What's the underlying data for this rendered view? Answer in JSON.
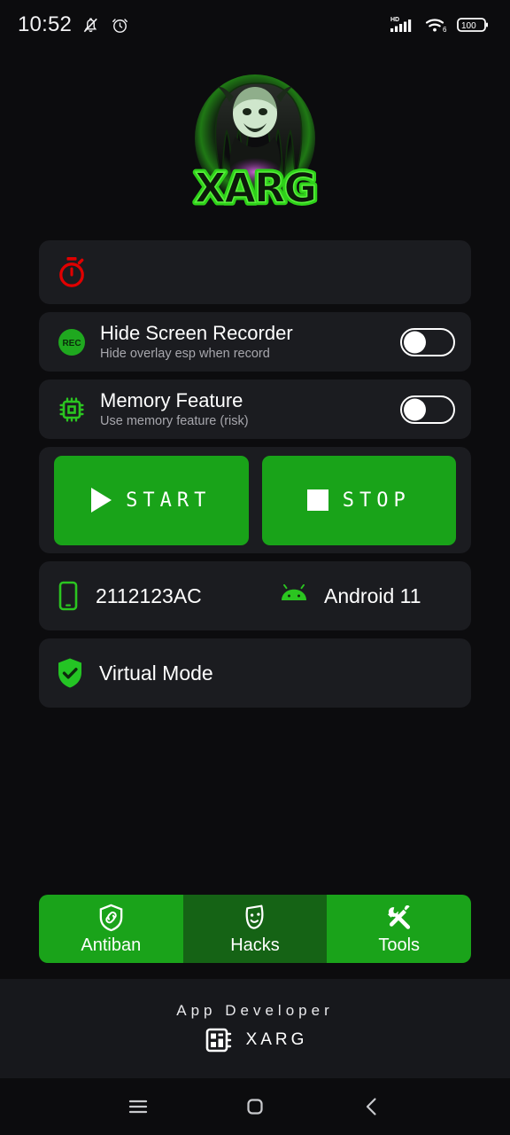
{
  "statusbar": {
    "time": "10:52",
    "icons_left": [
      "bell-muted-icon",
      "alarm-clock-icon"
    ],
    "hd_label": "HD",
    "wifi_generation": "6",
    "battery_level": "100",
    "icons_right": [
      "hd-signal-icon",
      "wifi-6-icon",
      "battery-icon"
    ]
  },
  "logo": {
    "name": "xarg-logo",
    "wordmark": "XARG",
    "glow_color": "#2fd21a"
  },
  "timer_card": {
    "icon": "stopwatch-icon",
    "icon_color": "#e00000"
  },
  "toggles": [
    {
      "icon": "rec-icon",
      "icon_label": "REC",
      "title": "Hide Screen Recorder",
      "subtitle": "Hide overlay esp when record",
      "state": "off"
    },
    {
      "icon": "memory-chip-icon",
      "title": "Memory Feature",
      "subtitle": "Use memory feature (risk)",
      "state": "off"
    }
  ],
  "actions": {
    "start_label": "START",
    "stop_label": "STOP",
    "start_icon": "play-icon",
    "stop_icon": "stop-icon",
    "button_color": "#19a319"
  },
  "device": {
    "model_icon": "phone-icon",
    "model": "2112123AC",
    "os_icon": "android-icon",
    "os": "Android 11"
  },
  "virtual_mode": {
    "icon": "shield-check-icon",
    "label": "Virtual Mode"
  },
  "tabs": [
    {
      "label": "Antiban",
      "icon": "shield-link-icon",
      "selected": false
    },
    {
      "label": "Hacks",
      "icon": "theater-mask-icon",
      "selected": true
    },
    {
      "label": "Tools",
      "icon": "wrench-screwdriver-icon",
      "selected": false
    }
  ],
  "footer": {
    "title": "App Developer",
    "icon": "chip-icon",
    "developer": "XARG"
  },
  "navbar": {
    "recents_icon": "menu-icon",
    "home_icon": "home-square-icon",
    "back_icon": "back-chevron-icon"
  },
  "colors": {
    "background": "#0c0c0e",
    "card": "#1b1c20",
    "accent_green": "#19a319",
    "accent_green_dark": "#156315",
    "icon_green": "#2bc520",
    "red": "#e00000"
  }
}
